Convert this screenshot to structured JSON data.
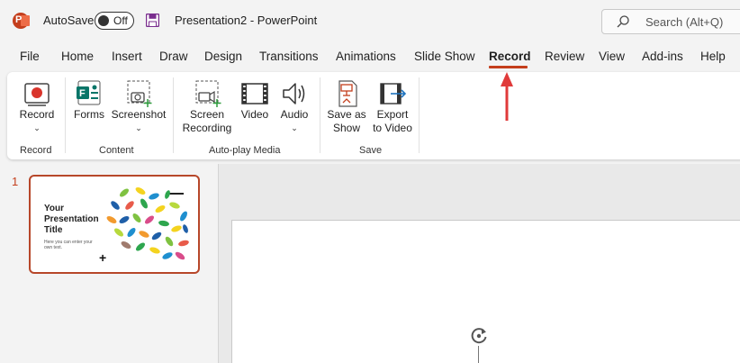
{
  "titlebar": {
    "app_logo_letter": "P",
    "autosave_label": "AutoSave",
    "autosave_state": "Off",
    "document_title": "Presentation2  -  PowerPoint",
    "search_placeholder": "Search (Alt+Q)"
  },
  "tabs": [
    {
      "label": "File"
    },
    {
      "label": "Home"
    },
    {
      "label": "Insert"
    },
    {
      "label": "Draw"
    },
    {
      "label": "Design"
    },
    {
      "label": "Transitions"
    },
    {
      "label": "Animations"
    },
    {
      "label": "Slide Show"
    },
    {
      "label": "Record",
      "active": true
    },
    {
      "label": "Review"
    },
    {
      "label": "View"
    },
    {
      "label": "Add-ins"
    },
    {
      "label": "Help"
    }
  ],
  "ribbon": {
    "groups": {
      "record": "Record",
      "content": "Content",
      "autoplay": "Auto-play Media",
      "save": "Save"
    },
    "commands": {
      "record": "Record",
      "forms": "Forms",
      "screenshot": "Screenshot",
      "screen_recording_1": "Screen",
      "screen_recording_2": "Recording",
      "video": "Video",
      "audio": "Audio",
      "save_as_show_1": "Save as",
      "save_as_show_2": "Show",
      "export_video_1": "Export",
      "export_video_2": "to Video"
    }
  },
  "slides": [
    {
      "number": "1",
      "title_line1": "Your",
      "title_line2": "Presentation",
      "title_line3": "Title",
      "subtitle": "Here you can enter your own text."
    }
  ],
  "colors": {
    "accent": "#c43e1c",
    "annotation_arrow": "#e03a3a",
    "thumb_border": "#b7472a"
  }
}
